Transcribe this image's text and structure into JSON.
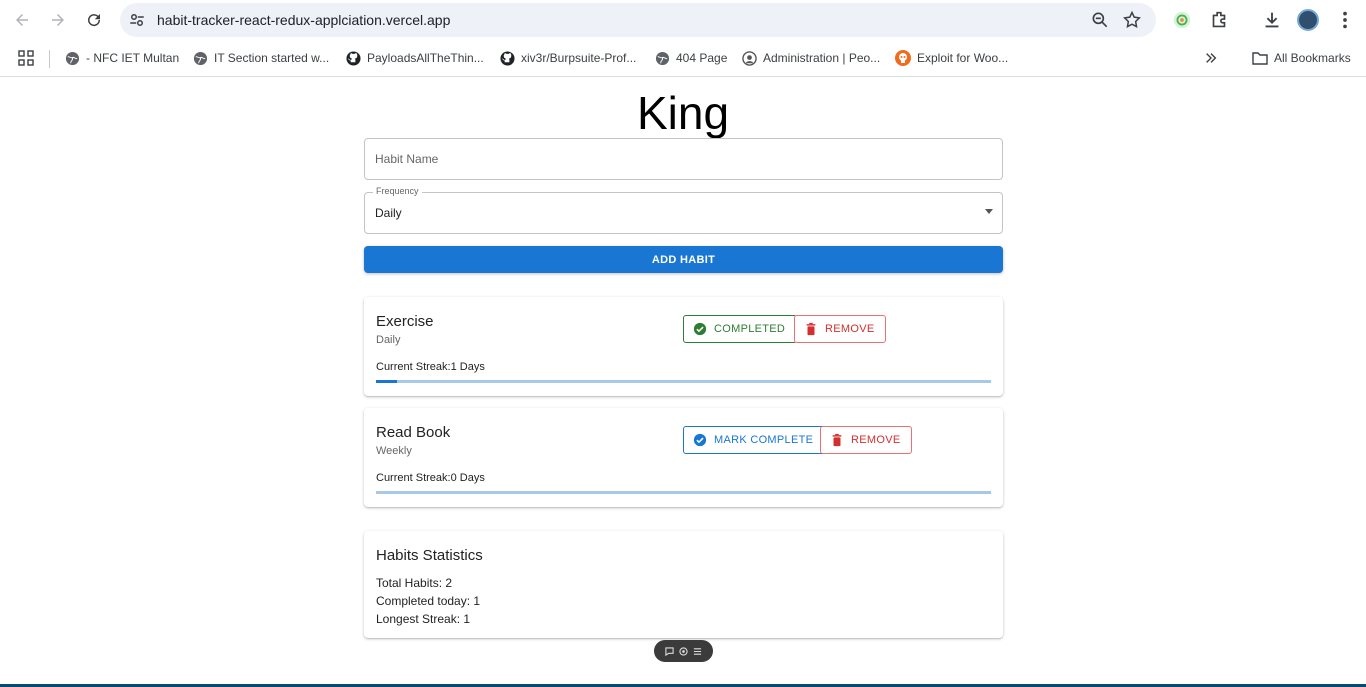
{
  "browser": {
    "url": "habit-tracker-react-redux-applciation.vercel.app",
    "bookmarks": [
      {
        "label": "- NFC IET Multan",
        "icon": "globe-icon"
      },
      {
        "label": "IT Section started w...",
        "icon": "globe-icon"
      },
      {
        "label": "PayloadsAllTheThin...",
        "icon": "github-icon"
      },
      {
        "label": "xiv3r/Burpsuite-Prof...",
        "icon": "github-icon"
      },
      {
        "label": "404 Page",
        "icon": "globe-icon"
      },
      {
        "label": "Administration | Peo...",
        "icon": "site-icon"
      },
      {
        "label": "Exploit for Woo...",
        "icon": "skull-icon"
      }
    ],
    "all_bookmarks_label": "All Bookmarks"
  },
  "app": {
    "title": "King",
    "habit_name_placeholder": "Habit Name",
    "frequency_label": "Frequency",
    "frequency_value": "Daily",
    "add_button": "ADD HABIT",
    "habits": [
      {
        "name": "Exercise",
        "frequency": "Daily",
        "status_button": "COMPLETED",
        "remove_button": "REMOVE",
        "streak_text": "Current Streak:1 Days",
        "progress_percent": 3.4
      },
      {
        "name": "Read Book",
        "frequency": "Weekly",
        "status_button": "MARK COMPLETE",
        "remove_button": "REMOVE",
        "streak_text": "Current Streak:0 Days",
        "progress_percent": 0
      }
    ],
    "stats": {
      "title": "Habits Statistics",
      "total": "Total Habits: 2",
      "completed": "Completed today: 1",
      "longest": "Longest Streak: 1"
    }
  },
  "colors": {
    "primary": "#1976d2",
    "success": "#2e7d32",
    "error": "#d32f2f"
  }
}
